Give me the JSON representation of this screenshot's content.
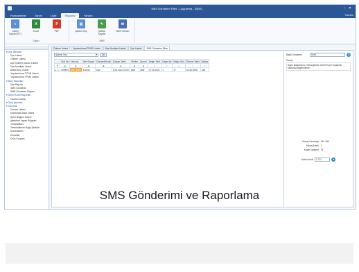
{
  "window": {
    "title": "SMS Gönderim Filtre - Uygulama - [SMS]"
  },
  "menu": {
    "tabs": [
      "Parametreler",
      "Tanım",
      "Liste",
      "Raporlar",
      "Yardım"
    ],
    "active_index": 3,
    "user": "Yardım"
  },
  "ribbon": {
    "groups": [
      {
        "label": "Dışarı",
        "buttons": [
          {
            "label": "Listeyi\nKaydet (F7)",
            "icon": "list-save-icon",
            "color": "#5b8fd6",
            "glyph": "≡"
          },
          {
            "label": "Excel",
            "icon": "excel-icon",
            "color": "#2e8b3e",
            "glyph": "X"
          },
          {
            "label": "PDF",
            "icon": "pdf-icon",
            "color": "#d33a2c",
            "glyph": "P"
          }
        ]
      },
      {
        "label": "SMS",
        "buttons": [
          {
            "label": "Şablon Seç",
            "icon": "template-icon",
            "color": "#5b8fd6",
            "glyph": "▤"
          },
          {
            "label": "Şablon\nKaydet",
            "icon": "template-save-icon",
            "color": "#4a9b4a",
            "glyph": "✎"
          },
          {
            "label": "SMS Gönder",
            "icon": "sms-send-icon",
            "color": "#4b6cb7",
            "glyph": "✉"
          }
        ]
      }
    ]
  },
  "sidebar": {
    "items": [
      {
        "label": "Üye İşlemleri",
        "group": true
      },
      {
        "label": "Üye Listesi",
        "group": false
      },
      {
        "label": "Ödeme Listesi",
        "group": false
      },
      {
        "label": "Üye Ödeme Durum Listesi",
        "group": false
      },
      {
        "label": "Üye Muafiyet Listesi",
        "group": false
      },
      {
        "label": "Aidat Borç Listesi",
        "group": false
      },
      {
        "label": "Yapılandırma TCDB Listesi",
        "group": false
      },
      {
        "label": "Yapılandırma TPMS Listesi",
        "group": false
      },
      {
        "label": "Borç Raporları",
        "group": true
      },
      {
        "label": "Üye Raporu",
        "group": false
      },
      {
        "label": "SMS Gönderim",
        "group": false
      },
      {
        "label": "SMS Gönderim Raporu",
        "group": false
      },
      {
        "label": "Genel Kurul Raporları",
        "group": true
      },
      {
        "label": "Hazirun Listesi",
        "group": false
      },
      {
        "label": "Ödül İşlemleri",
        "group": true
      },
      {
        "label": "Tanımlar",
        "group": true
      },
      {
        "label": "Dernek Listesi",
        "group": false
      },
      {
        "label": "Dönemsel Aidat Listesi",
        "group": false
      },
      {
        "label": "Şehir Bilgileri Listesi",
        "group": false
      },
      {
        "label": "İşlemlere Yapan Bölgeler",
        "group": false
      },
      {
        "label": "Temsilcilikler",
        "group": false
      },
      {
        "label": "Temsilciliklere Bağlı Şehirler",
        "group": false
      },
      {
        "label": "Üniversiteler",
        "group": false
      },
      {
        "label": "Ünvanlar",
        "group": false
      },
      {
        "label": "Ürün Grupları",
        "group": false
      }
    ]
  },
  "doc_tabs": {
    "items": [
      "Ödeme Listesi",
      "Yapılandırma TPMS Listesi",
      "Üye Muafiyet Listesi",
      "Üye Listesi",
      "SMS Gönderim Filtre"
    ],
    "active_index": 4
  },
  "grid": {
    "template_value": "Şablon Seç",
    "go_label": "Git",
    "columns": [
      "",
      "Sicil No",
      "Üye Adı",
      "Üye Soyadı",
      "Gönderi/Kimlik",
      "Doğum Tarihi",
      "Telefon",
      "Durum",
      "Değer Tarih",
      "Değer Ay",
      "Değer Gün",
      "Ödeme Tarihi",
      "Bakiye"
    ],
    "filter_symbols": [
      "▼",
      "◆",
      "◆",
      "◆",
      "◆",
      "◆",
      "◆",
      "◆",
      "=",
      "=",
      "=",
      "=",
      "="
    ],
    "rows": [
      [
        "▸ ☐",
        "009496",
        "ŞEF KARI",
        "KILINÇ",
        "Üye",
        "5.05.2022 00:00",
        "Aktif",
        "Aktif",
        "17.05.2021",
        "1",
        "17",
        "04.06.2008",
        "360"
      ]
    ]
  },
  "right_panel": {
    "sending_label": "Bağlı Gönderim",
    "sending_value": "SMS",
    "message_label": "Mesaj:",
    "message_text": "Sayın Başkanımız, Derneğimizin Genel Kurul Toplantısı hakkında bilgilendirme...",
    "stats": [
      {
        "key": "Mesaj Uzunluğu",
        "value": "69 / 160"
      },
      {
        "key": "Mesaj Adedi",
        "value": "1"
      },
      {
        "key": "Kalan karakter",
        "value": "91"
      }
    ],
    "send_count_label": "Kalan Kredi",
    "send_count_value": "1.711"
  },
  "caption": "SMS Gönderimi ve Raporlama"
}
